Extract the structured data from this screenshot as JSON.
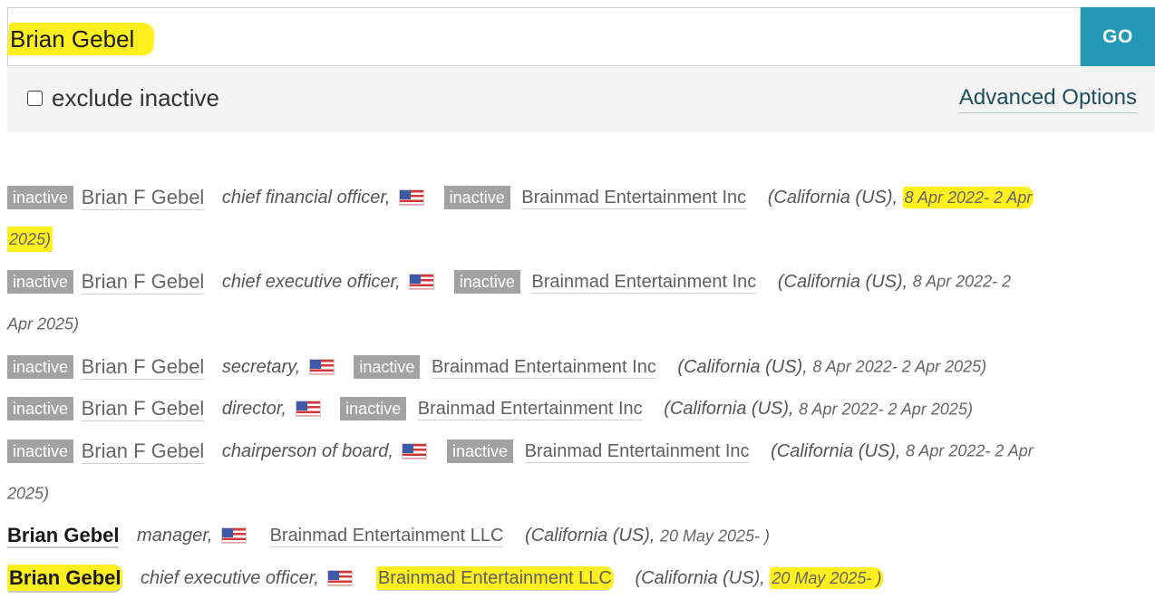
{
  "search": {
    "value": "Brian Gebel",
    "go_label": "GO",
    "exclude_inactive_label": "exclude inactive",
    "advanced_options_label": "Advanced Options"
  },
  "colors": {
    "go_button": "#2499b5",
    "highlight": "#ffef1e",
    "badge": "#a2a2a2"
  },
  "results": [
    {
      "status": "inactive",
      "name": "Brian F Gebel",
      "role": "chief financial officer,",
      "company_status": "inactive",
      "company": "Brainmad Entertainment Inc",
      "jurisdiction": "(California (US),",
      "dates_a": "8 Apr 2022- 2 Apr",
      "dates_b": "2025)"
    },
    {
      "status": "inactive",
      "name": "Brian F Gebel",
      "role": "chief executive officer,",
      "company_status": "inactive",
      "company": "Brainmad Entertainment Inc",
      "jurisdiction": "(California (US),",
      "dates_a": "8 Apr 2022- 2",
      "dates_b": "Apr 2025)"
    },
    {
      "status": "inactive",
      "name": "Brian F Gebel",
      "role": "secretary,",
      "company_status": "inactive",
      "company": "Brainmad Entertainment Inc",
      "jurisdiction": "(California (US),",
      "dates_a": "8 Apr 2022- 2 Apr 2025)"
    },
    {
      "status": "inactive",
      "name": "Brian F Gebel",
      "role": "director,",
      "company_status": "inactive",
      "company": "Brainmad Entertainment Inc",
      "jurisdiction": "(California (US),",
      "dates_a": "8 Apr 2022- 2 Apr 2025)"
    },
    {
      "status": "inactive",
      "name": "Brian F Gebel",
      "role": "chairperson of board,",
      "company_status": "inactive",
      "company": "Brainmad Entertainment Inc",
      "jurisdiction": "(California (US),",
      "dates_a": "8 Apr 2022- 2 Apr",
      "dates_b": "2025)"
    },
    {
      "name": "Brian Gebel",
      "role": "manager,",
      "company": "Brainmad Entertainment LLC",
      "jurisdiction": "(California (US),",
      "dates_a": "20 May 2025- )"
    },
    {
      "name": "Brian Gebel",
      "role": "chief executive officer,",
      "company": "Brainmad Entertainment LLC",
      "jurisdiction": "(California (US),",
      "dates_a": "20 May 2025- )"
    }
  ],
  "icons": {
    "flag": "us-flag-icon"
  }
}
